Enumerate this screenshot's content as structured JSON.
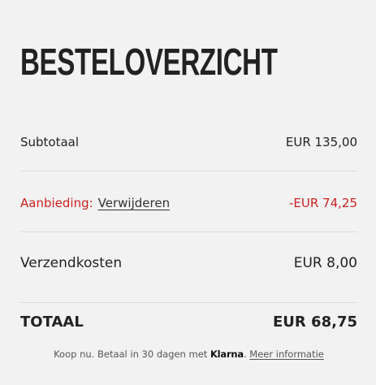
{
  "title": "BESTELOVERZICHT",
  "subtotal": {
    "label": "Subtotaal",
    "value": "EUR 135,00"
  },
  "discount": {
    "label": "Aanbieding:",
    "remove_link": "Verwijderen",
    "value": "-EUR 74,25"
  },
  "shipping": {
    "label": "Verzendkosten",
    "value": "EUR 8,00"
  },
  "total": {
    "label": "TOTAAL",
    "value": "EUR 68,75"
  },
  "klarna": {
    "text": "Koop nu. Betaal in 30 dagen met",
    "brand": "Klarna",
    "period": ".",
    "more_info": "Meer informatie"
  },
  "colors": {
    "background": "#f2f2f2",
    "text": "#222222",
    "discount_red": "#cc2222",
    "divider": "#dcdcdc"
  }
}
